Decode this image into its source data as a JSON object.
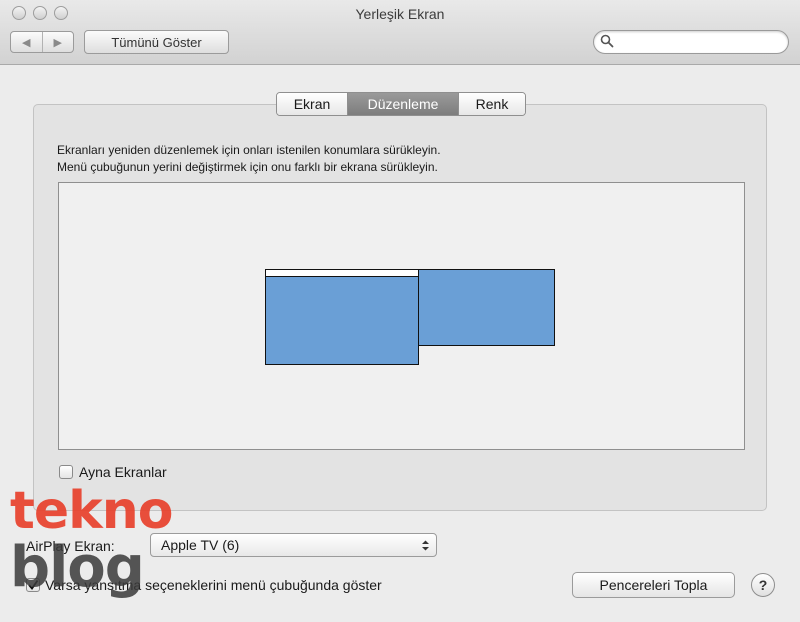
{
  "window": {
    "title": "Yerleşik Ekran",
    "show_all_label": "Tümünü Göster",
    "search_placeholder": ""
  },
  "tabs": [
    {
      "label": "Ekran",
      "active": false
    },
    {
      "label": "Düzenleme",
      "active": true
    },
    {
      "label": "Renk",
      "active": false
    }
  ],
  "arrangement": {
    "instruction_1": "Ekranları yeniden düzenlemek için onları istenilen konumlara sürükleyin.",
    "instruction_2": "Menü çubuğunun yerini değiştirmek için onu farklı bir ekrana sürükleyin.",
    "display_color": "#6a9fd6"
  },
  "mirror": {
    "label": "Ayna Ekranlar",
    "checked": false
  },
  "airplay": {
    "label": "AirPlay Ekran:",
    "selected": "Apple TV (6)"
  },
  "mirroring_option": {
    "label": "Varsa yansıtma seçeneklerini menü çubuğunda göster",
    "checked": true
  },
  "gather_button": "Pencereleri Topla",
  "help_label": "?",
  "watermark": {
    "line1": "tekno",
    "line2": "blog",
    "color1": "#e8412c",
    "color2": "#3a3a3a"
  }
}
